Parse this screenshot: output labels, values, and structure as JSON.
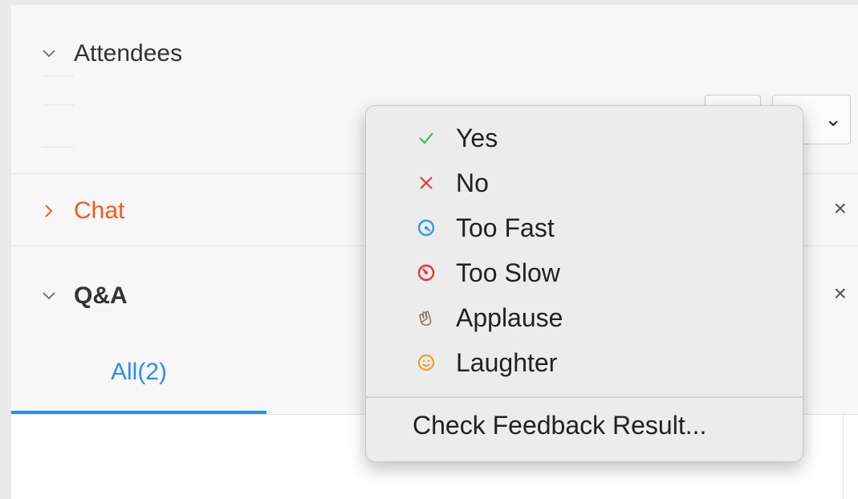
{
  "sections": {
    "attendees": {
      "title": "Attendees"
    },
    "chat": {
      "title": "Chat"
    },
    "qa": {
      "title": "Q&A"
    }
  },
  "tabs": [
    {
      "label": "All(2)",
      "active": true
    }
  ],
  "feedback_menu": {
    "items": [
      {
        "label": "Yes",
        "icon": "check-icon",
        "color": "#2eb84b"
      },
      {
        "label": "No",
        "icon": "x-icon",
        "color": "#e8333a"
      },
      {
        "label": "Too Fast",
        "icon": "speed-fast-icon",
        "color": "#2d9ee0"
      },
      {
        "label": "Too Slow",
        "icon": "speed-slow-icon",
        "color": "#e8333a"
      },
      {
        "label": "Applause",
        "icon": "clap-icon",
        "color": "#8a7a6a"
      },
      {
        "label": "Laughter",
        "icon": "smile-icon",
        "color": "#f0a020"
      }
    ],
    "footer_label": "Check Feedback Result..."
  },
  "colors": {
    "accent_blue": "#2d8cf0",
    "chat_orange": "#f6591c"
  }
}
